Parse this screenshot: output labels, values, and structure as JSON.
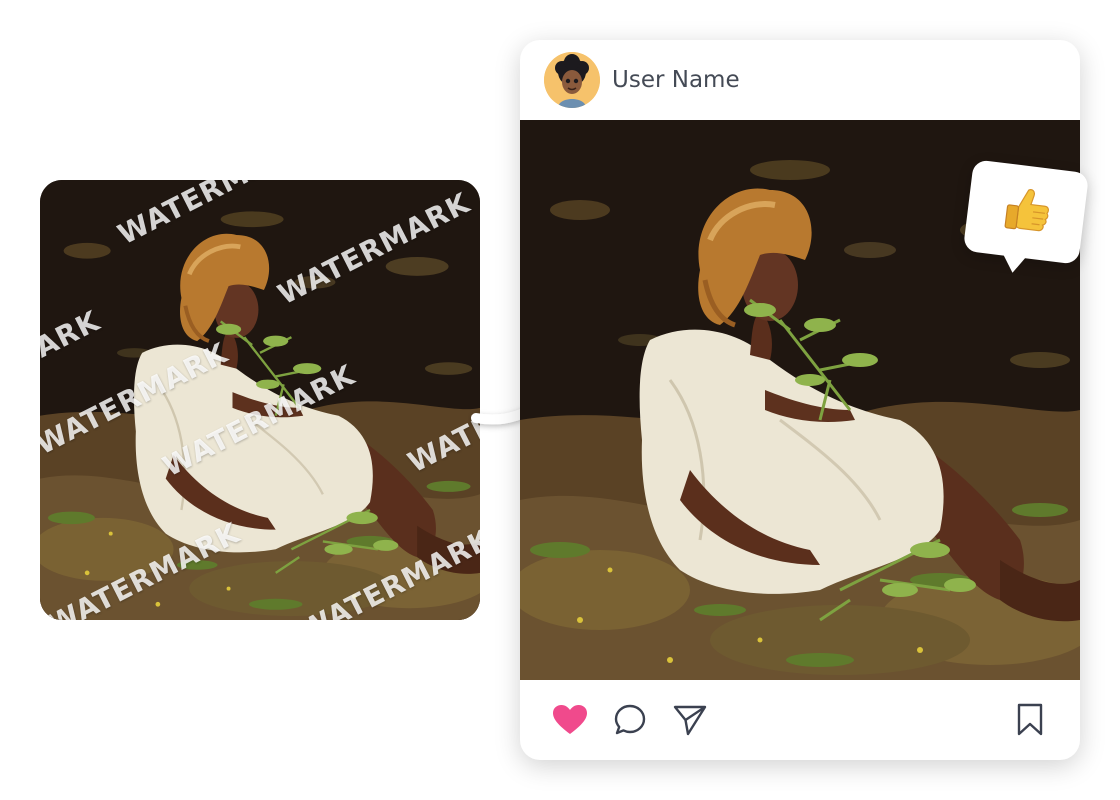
{
  "source_photo": {
    "watermark_label": "WATERMARK",
    "watermark_count": 8
  },
  "post": {
    "user_name": "User Name",
    "avatar_icon": "avatar-icon",
    "actions": {
      "like_icon": "heart-icon",
      "comment_icon": "comment-icon",
      "share_icon": "send-icon",
      "save_icon": "bookmark-icon"
    },
    "liked": true
  },
  "reaction": {
    "icon": "thumbs-up-icon"
  },
  "colors": {
    "like": "#f04a8c",
    "avatar_bg": "#f6c26b",
    "reaction_emoji": "#f5c33b",
    "text": "#444a55"
  }
}
